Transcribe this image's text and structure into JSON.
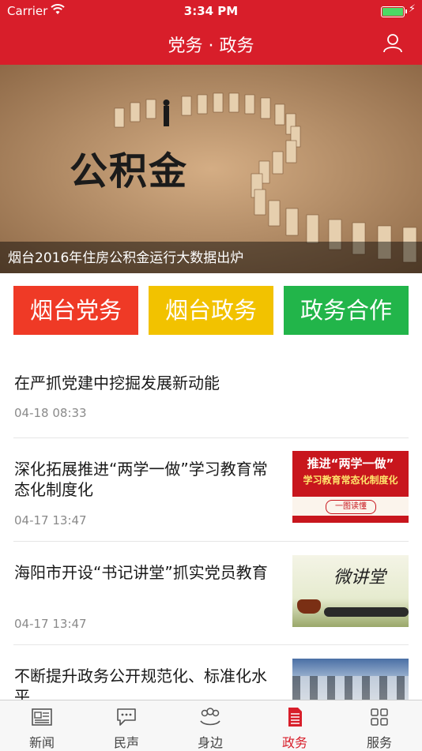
{
  "status_bar": {
    "carrier": "Carrier",
    "time": "3:34 PM"
  },
  "nav": {
    "title": "党务 · 政务"
  },
  "banner": {
    "caption": "烟台2016年住房公积金运行大数据出炉",
    "image_text": "公积金"
  },
  "category_buttons": [
    "烟台党务",
    "烟台政务",
    "政务合作"
  ],
  "news": [
    {
      "title": "在严抓党建中挖掘发展新动能",
      "date": "04-18 08:33"
    },
    {
      "title": "深化拓展推进“两学一做”学习教育常态化制度化",
      "date": "04-17 13:47",
      "thumb_text": [
        "推进“两学一做”",
        "学习教育常态化制度化",
        "一图读懂"
      ]
    },
    {
      "title": "海阳市开设“书记讲堂”抓实党员教育",
      "date": "04-17 13:47",
      "thumb_text": [
        "微讲堂"
      ]
    },
    {
      "title": "不断提升政务公开规范化、标准化水平",
      "date": ""
    }
  ],
  "tabs": [
    {
      "label": "新闻",
      "icon": "newspaper-icon",
      "active": false
    },
    {
      "label": "民声",
      "icon": "chat-bubble-icon",
      "active": false
    },
    {
      "label": "身边",
      "icon": "people-icon",
      "active": false
    },
    {
      "label": "政务",
      "icon": "document-icon",
      "active": true
    },
    {
      "label": "服务",
      "icon": "grid-icon",
      "active": false
    }
  ],
  "colors": {
    "brand_red": "#d81e2a",
    "btn_red": "#ef3a26",
    "btn_yellow": "#f2c200",
    "btn_green": "#22b54a"
  }
}
